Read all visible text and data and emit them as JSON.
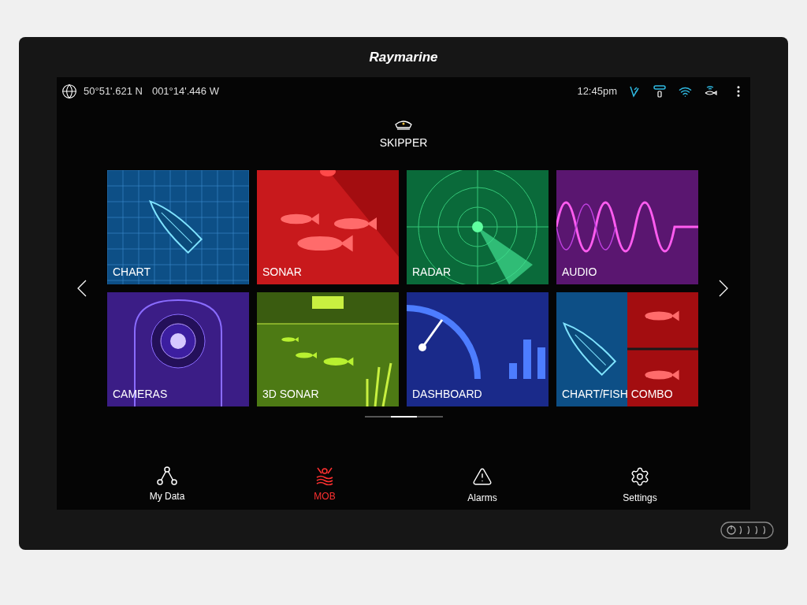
{
  "device": {
    "brand": "Raymarine"
  },
  "status_bar": {
    "position": [
      "50°51'.621 N",
      "001°14'.446 W"
    ],
    "time": "12:45pm"
  },
  "profile": {
    "name": "SKIPPER"
  },
  "apps": [
    {
      "label": "CHART",
      "kind": "chart"
    },
    {
      "label": "SONAR",
      "kind": "sonar"
    },
    {
      "label": "RADAR",
      "kind": "radar"
    },
    {
      "label": "AUDIO",
      "kind": "audio"
    },
    {
      "label": "CAMERAS",
      "kind": "cameras"
    },
    {
      "label": "3D SONAR",
      "kind": "sonar3d"
    },
    {
      "label": "DASHBOARD",
      "kind": "dashboard"
    },
    {
      "label": "CHART/FISH COMBO",
      "kind": "combo"
    }
  ],
  "pages": [
    {
      "selected": false
    },
    {
      "selected": true
    },
    {
      "selected": false
    }
  ],
  "bottom_bar": [
    {
      "label": "My Data",
      "kind": "mydata"
    },
    {
      "label": "MOB",
      "kind": "mob"
    },
    {
      "label": "Alarms",
      "kind": "alarms"
    },
    {
      "label": "Settings",
      "kind": "settings"
    }
  ]
}
